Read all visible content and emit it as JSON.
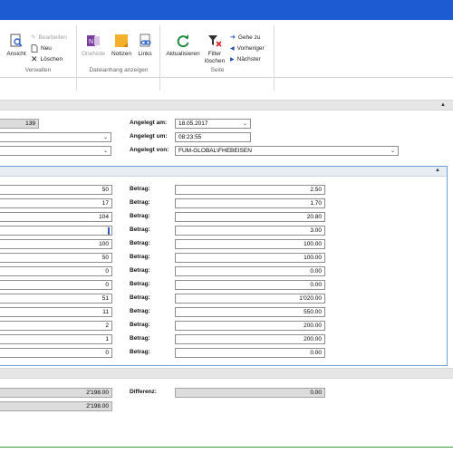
{
  "ribbon": {
    "verwalten": {
      "ansicht": "Ansicht",
      "bearbeiten": "Bearbeiten",
      "neu": "Neu",
      "loeschen": "Löschen",
      "group_label": "Verwalten"
    },
    "dateianhang": {
      "onenote": "OneNote",
      "notizen": "Notizen",
      "links": "Links",
      "group_label": "Dateianhang anzeigen"
    },
    "seite": {
      "aktualisieren": "Aktualisieren",
      "filter_line1": "Filter",
      "filter_line2": "löschen",
      "gehe_zu": "Gehe zu",
      "vorheriger": "Vorheriger",
      "naechster": "Nächster",
      "group_label": "Seite"
    }
  },
  "header": {
    "number_value": "139",
    "angelegt_am_label": "Angelegt am:",
    "angelegt_am_value": "18.05.2017",
    "angelegt_um_label": "Angelegt um:",
    "angelegt_um_value": "08:23:55",
    "angelegt_von_label": "Angelegt von:",
    "angelegt_von_value": "FUM-GLOBAL\\FHEBEISEN"
  },
  "rows": {
    "betrag_label": "Betrag:",
    "items": [
      {
        "qty": "50",
        "betrag": "2.50"
      },
      {
        "qty": "17",
        "betrag": "1.70"
      },
      {
        "qty": "104",
        "betrag": "20.80"
      },
      {
        "qty": "",
        "betrag": "3.00"
      },
      {
        "qty": "100",
        "betrag": "100.00"
      },
      {
        "qty": "50",
        "betrag": "100.00"
      },
      {
        "qty": "0",
        "betrag": "0.00"
      },
      {
        "qty": "0",
        "betrag": "0.00"
      },
      {
        "qty": "51",
        "betrag": "1'020.00"
      },
      {
        "qty": "11",
        "betrag": "550.00"
      },
      {
        "qty": "2",
        "betrag": "200.00"
      },
      {
        "qty": "1",
        "betrag": "200.00"
      },
      {
        "qty": "0",
        "betrag": "0.00"
      }
    ]
  },
  "totals": {
    "total1": "2'198.00",
    "total2": "2'198.00",
    "differenz_label": "Differenz:",
    "differenz_value": "0.00"
  },
  "colors": {
    "titlebar": "#1c5bd1",
    "panel_border": "#6aa2d8"
  }
}
